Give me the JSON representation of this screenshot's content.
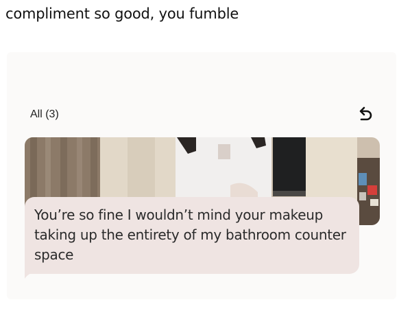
{
  "tweet": {
    "text": "compliment so good, you fumble"
  },
  "filter": {
    "label": "All (3)"
  },
  "undo": {
    "icon": "undo-arrow-icon"
  },
  "message": {
    "text": "You’re so fine I wouldn’t mind your makeup taking up the entirety of my bathroom counter space"
  },
  "colors": {
    "message_bg": "#efe4e2",
    "card_bg": "#fbfaf9"
  }
}
